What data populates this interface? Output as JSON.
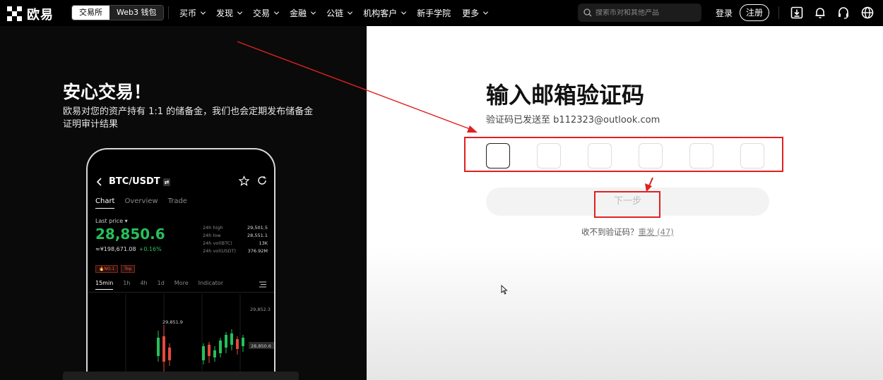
{
  "nav": {
    "logo_text": "欧易",
    "switch": {
      "exchange": "交易所",
      "web3": "Web3 钱包"
    },
    "menu": [
      {
        "label": "买币",
        "dropdown": true
      },
      {
        "label": "发现",
        "dropdown": true
      },
      {
        "label": "交易",
        "dropdown": true
      },
      {
        "label": "金融",
        "dropdown": true
      },
      {
        "label": "公链",
        "dropdown": true
      },
      {
        "label": "机构客户",
        "dropdown": true
      },
      {
        "label": "新手学院",
        "dropdown": false
      },
      {
        "label": "更多",
        "dropdown": true
      }
    ],
    "search_placeholder": "搜索币对和其他产品",
    "login": "登录",
    "register": "注册",
    "icons": [
      "download-icon",
      "bell-icon",
      "headset-icon",
      "globe-icon"
    ]
  },
  "promo": {
    "title": "安心交易！",
    "desc": "欧易对您的资产持有 1:1 的储备金，我们也会定期发布储备金证明审计结果",
    "phone": {
      "pair": "BTC/USDT",
      "tabs": [
        "Chart",
        "Overview",
        "Trade"
      ],
      "last_price_label": "Last price ▾",
      "price": "28,850.6",
      "cny": "≈¥198,671.08",
      "pct": "+0.16%",
      "stats": [
        {
          "label": "24h high",
          "value": "29,501.5"
        },
        {
          "label": "24h low",
          "value": "28,551.1"
        },
        {
          "label": "24h vol(BTC)",
          "value": "13K"
        },
        {
          "label": "24h vol(USDT)",
          "value": "376.92M"
        }
      ],
      "badges": [
        "🔥NO.1",
        "Top"
      ],
      "timeframes": [
        "15min",
        "1h",
        "4h",
        "1d",
        "More",
        "Indicator"
      ],
      "chart_labels": {
        "high": "29,851.9",
        "right_top": "29,852.3",
        "right_bottom": "28,850.6"
      }
    }
  },
  "form": {
    "title": "输入邮箱验证码",
    "sent_prefix": "验证码已发送至 ",
    "email": "b112323@outlook.com",
    "next_label": "下一步",
    "resend_prefix": "收不到验证码？",
    "resend_label": "重发 (47)"
  },
  "colors": {
    "annotation_red": "#e02020",
    "price_green": "#25c05b",
    "candle_red": "#e5493d"
  }
}
